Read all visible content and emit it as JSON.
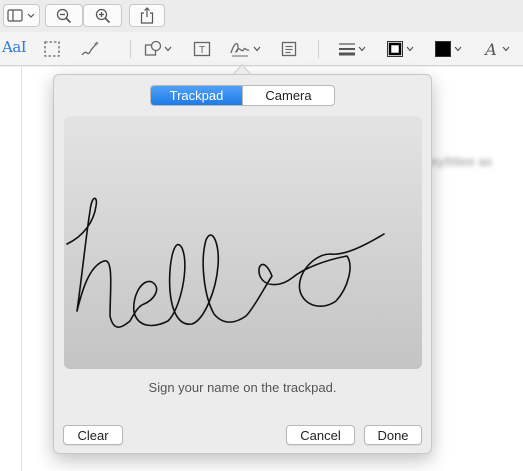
{
  "toolbar": {
    "sidebar_icon": "sidebar-icon",
    "zoom_out_icon": "zoom-out-icon",
    "zoom_in_icon": "zoom-in-icon",
    "share_icon": "share-icon"
  },
  "markup_toolbar": {
    "text_style_label": "AaI",
    "tools": [
      "rectangular-selection-icon",
      "sketch-icon",
      "shapes-icon",
      "text-box-icon",
      "signature-icon",
      "note-icon",
      "line-style-icon",
      "border-color-icon",
      "fill-color-icon",
      "font-icon"
    ],
    "accent_color": "#2f7bd9"
  },
  "document": {
    "visible_fragment": "ey/titlee as"
  },
  "signature_popover": {
    "tabs": [
      {
        "label": "Trackpad",
        "active": true
      },
      {
        "label": "Camera",
        "active": false
      }
    ],
    "instruction": "Sign your name on the trackpad.",
    "buttons": {
      "clear": "Clear",
      "cancel": "Cancel",
      "done": "Done"
    },
    "active_tab_color": "#1f7ae8"
  }
}
